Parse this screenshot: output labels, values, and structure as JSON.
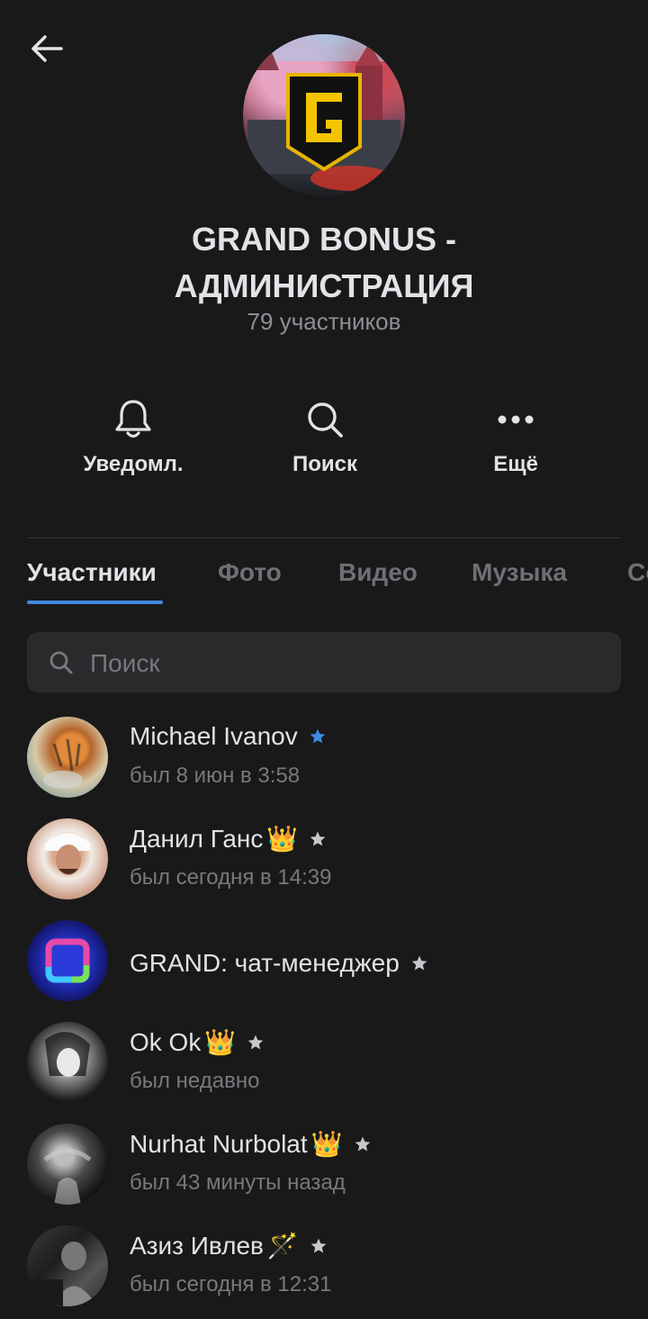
{
  "header": {
    "back_icon": "arrow-left-icon",
    "title_line1": "GRAND BONUS -",
    "title_line2": "АДМИНИСТРАЦИЯ",
    "members_count": "79 участников"
  },
  "actions": [
    {
      "icon": "bell-icon",
      "label": "Уведомл."
    },
    {
      "icon": "search-icon",
      "label": "Поиск"
    },
    {
      "icon": "more-icon",
      "label": "Ещё"
    }
  ],
  "tabs": [
    "Участники",
    "Фото",
    "Видео",
    "Музыка",
    "Со"
  ],
  "active_tab": "Участники",
  "search": {
    "placeholder": "Поиск"
  },
  "members": [
    {
      "name": "Michael Ivanov",
      "emoji": "",
      "star_color": "#3f8ae0",
      "status": "был 8 июн в 3:58"
    },
    {
      "name": "Данил Ганс",
      "emoji": "👑",
      "star_color": "#c4c8cc",
      "status": "был сегодня в 14:39"
    },
    {
      "name": "GRAND: чат-менеджер",
      "emoji": "",
      "star_color": "#c4c8cc",
      "status": ""
    },
    {
      "name": "Ok Ok",
      "emoji": "👑",
      "star_color": "#c4c8cc",
      "status": "был недавно"
    },
    {
      "name": "Nurhat Nurbolat",
      "emoji": "👑",
      "star_color": "#c4c8cc",
      "status": "был 43 минуты назад"
    },
    {
      "name": "Азиз Ивлев",
      "emoji": "🪄",
      "star_color": "#c4c8cc",
      "status": "был сегодня в 12:31"
    }
  ],
  "colors": {
    "accent": "#3f8ae0",
    "background": "#19191a",
    "secondary_text": "#77797d"
  }
}
